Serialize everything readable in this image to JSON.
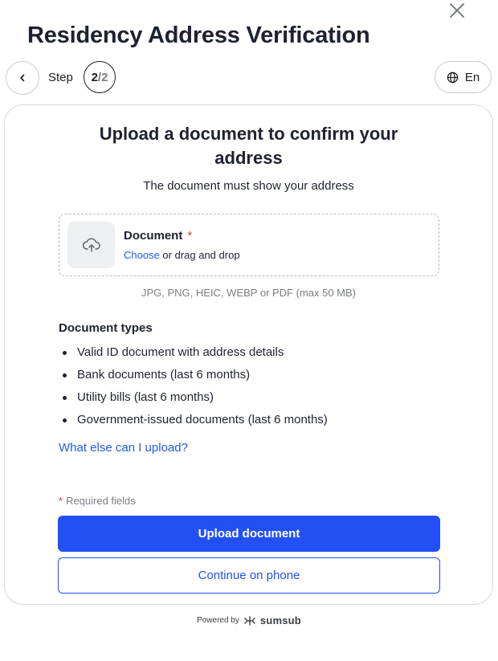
{
  "header": {
    "title": "Residency Address Verification",
    "close_icon": "close-icon"
  },
  "nav": {
    "back_icon": "chevron-left-icon",
    "step_label": "Step",
    "step_current": "2",
    "step_total": "/2",
    "language": "En",
    "language_icon": "globe-icon"
  },
  "card": {
    "title_line1": "Upload a document to confirm your",
    "title_line2": "address",
    "subtitle": "The document must show your address",
    "dropzone": {
      "label": "Document",
      "required_mark": "*",
      "choose_label": "Choose",
      "drag_text": " or drag and drop",
      "icon": "cloud-upload-icon"
    },
    "formats": "JPG, PNG, HEIC, WEBP or PDF (max 50 MB)",
    "types_heading": "Document types",
    "types": [
      "Valid ID document with address details",
      "Bank documents (last 6 months)",
      "Utility bills (last 6 months)",
      "Government-issued documents (last 6 months)"
    ],
    "what_else_link": "What else can I upload?",
    "required_note_star": "*",
    "required_note": "Required fields",
    "primary_button": "Upload document",
    "secondary_button": "Continue on phone"
  },
  "footer": {
    "powered_by": "Powered by",
    "brand": "sumsub"
  },
  "colors": {
    "accent": "#2350f5",
    "link": "#1f5ae6",
    "required": "#e53935"
  }
}
